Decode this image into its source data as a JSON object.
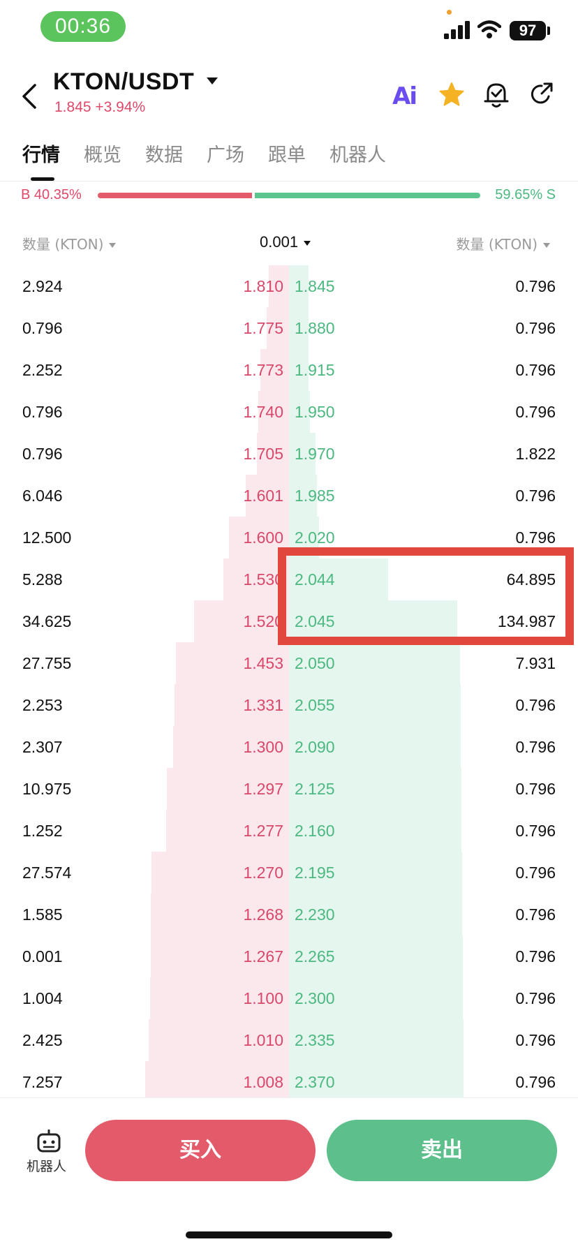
{
  "status_bar": {
    "time": "00:36",
    "battery": "97"
  },
  "header": {
    "pair": "KTON/USDT",
    "price_change": "1.845 +3.94%",
    "ai_label": "Ai"
  },
  "tabs": [
    {
      "label": "行情",
      "active": true
    },
    {
      "label": "概览",
      "active": false
    },
    {
      "label": "数据",
      "active": false
    },
    {
      "label": "广场",
      "active": false
    },
    {
      "label": "跟单",
      "active": false
    },
    {
      "label": "机器人",
      "active": false
    }
  ],
  "ratio": {
    "buy_label": "B 40.35%",
    "sell_label": "59.65% S",
    "buy_fraction": 0.4035
  },
  "columns": {
    "left": "数量 (KTON)",
    "middle": "0.001",
    "right": "数量 (KTON)"
  },
  "order_book": [
    {
      "bid_qty": "2.924",
      "bid_price": "1.810",
      "ask_price": "1.845",
      "ask_qty": "0.796"
    },
    {
      "bid_qty": "0.796",
      "bid_price": "1.775",
      "ask_price": "1.880",
      "ask_qty": "0.796"
    },
    {
      "bid_qty": "2.252",
      "bid_price": "1.773",
      "ask_price": "1.915",
      "ask_qty": "0.796"
    },
    {
      "bid_qty": "0.796",
      "bid_price": "1.740",
      "ask_price": "1.950",
      "ask_qty": "0.796"
    },
    {
      "bid_qty": "0.796",
      "bid_price": "1.705",
      "ask_price": "1.970",
      "ask_qty": "1.822"
    },
    {
      "bid_qty": "6.046",
      "bid_price": "1.601",
      "ask_price": "1.985",
      "ask_qty": "0.796"
    },
    {
      "bid_qty": "12.500",
      "bid_price": "1.600",
      "ask_price": "2.020",
      "ask_qty": "0.796"
    },
    {
      "bid_qty": "5.288",
      "bid_price": "1.530",
      "ask_price": "2.044",
      "ask_qty": "64.895"
    },
    {
      "bid_qty": "34.625",
      "bid_price": "1.520",
      "ask_price": "2.045",
      "ask_qty": "134.987"
    },
    {
      "bid_qty": "27.755",
      "bid_price": "1.453",
      "ask_price": "2.050",
      "ask_qty": "7.931"
    },
    {
      "bid_qty": "2.253",
      "bid_price": "1.331",
      "ask_price": "2.055",
      "ask_qty": "0.796"
    },
    {
      "bid_qty": "2.307",
      "bid_price": "1.300",
      "ask_price": "2.090",
      "ask_qty": "0.796"
    },
    {
      "bid_qty": "10.975",
      "bid_price": "1.297",
      "ask_price": "2.125",
      "ask_qty": "0.796"
    },
    {
      "bid_qty": "1.252",
      "bid_price": "1.277",
      "ask_price": "2.160",
      "ask_qty": "0.796"
    },
    {
      "bid_qty": "27.574",
      "bid_price": "1.270",
      "ask_price": "2.195",
      "ask_qty": "0.796"
    },
    {
      "bid_qty": "1.585",
      "bid_price": "1.268",
      "ask_price": "2.230",
      "ask_qty": "0.796"
    },
    {
      "bid_qty": "0.001",
      "bid_price": "1.267",
      "ask_price": "2.265",
      "ask_qty": "0.796"
    },
    {
      "bid_qty": "1.004",
      "bid_price": "1.100",
      "ask_price": "2.300",
      "ask_qty": "0.796"
    },
    {
      "bid_qty": "2.425",
      "bid_price": "1.010",
      "ask_price": "2.335",
      "ask_qty": "0.796"
    },
    {
      "bid_qty": "7.257",
      "bid_price": "1.008",
      "ask_price": "2.370",
      "ask_qty": "0.796"
    }
  ],
  "bottom": {
    "robot_label": "机器人",
    "buy": "买入",
    "sell": "卖出"
  },
  "colors": {
    "buy": "#e35b6b",
    "sell": "#5cbf8c",
    "highlight": "#e2473c",
    "time_pill": "#5cc45c"
  }
}
